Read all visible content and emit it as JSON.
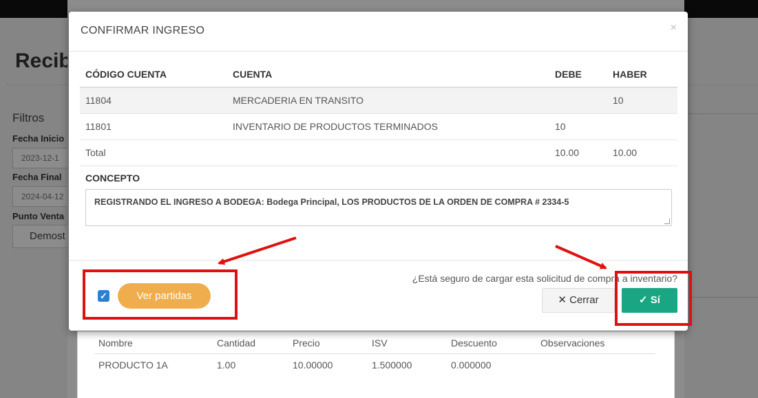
{
  "background": {
    "page_title": "Recibi",
    "filters_heading": "Filtros",
    "fecha_inicio_label": "Fecha Inicio",
    "fecha_inicio_value": "2023-12-1",
    "fecha_final_label": "Fecha Final",
    "fecha_final_value": "2024-04-12",
    "punto_venta_label": "Punto Venta",
    "punto_venta_value": "Demost"
  },
  "products": {
    "headers": [
      "Nombre",
      "Cantidad",
      "Precio",
      "ISV",
      "Descuento",
      "Observaciones"
    ],
    "rows": [
      {
        "nombre": "PRODUCTO 1A",
        "cantidad": "1.00",
        "precio": "10.00000",
        "isv": "1.500000",
        "descuento": "0.000000",
        "observaciones": ""
      }
    ]
  },
  "modal": {
    "title": "CONFIRMAR INGRESO",
    "close_glyph": "×",
    "table": {
      "headers": {
        "codigo": "CÓDIGO CUENTA",
        "cuenta": "CUENTA",
        "debe": "DEBE",
        "haber": "HABER"
      },
      "rows": [
        {
          "codigo": "11804",
          "cuenta": "MERCADERIA EN TRANSITO",
          "debe": "",
          "haber": "10"
        },
        {
          "codigo": "11801",
          "cuenta": "INVENTARIO DE PRODUCTOS TERMINADOS",
          "debe": "10",
          "haber": ""
        }
      ],
      "total": {
        "label": "Total",
        "debe": "10.00",
        "haber": "10.00"
      }
    },
    "concepto_label": "CONCEPTO",
    "concepto_text": "REGISTRANDO EL INGRESO A BODEGA: Bodega Principal, LOS PRODUCTOS DE LA ORDEN DE COMPRA # 2334-5",
    "checkbox_checked": true,
    "checkbox_glyph": "✓",
    "ver_partidas_label": "Ver partidas",
    "confirm_question": "¿Está seguro de cargar esta solicitud de compra a inventario?",
    "cerrar_label": "✕ Cerrar",
    "si_label": "✓ Sí"
  },
  "colors": {
    "primary_checkbox": "#2f7fd1",
    "warning_button": "#f0ad4e",
    "success_button": "#1aa583",
    "annotation_red": "#e01010"
  }
}
